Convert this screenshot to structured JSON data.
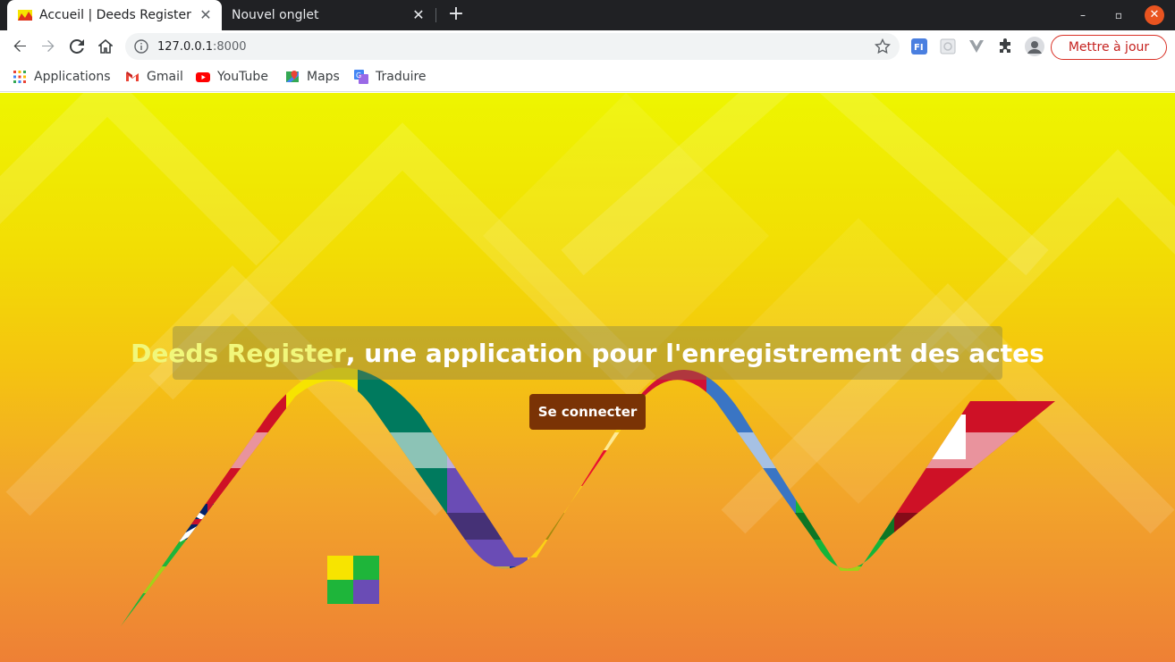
{
  "browser": {
    "tabs": [
      {
        "title": "Accueil | Deeds Register",
        "active": true
      },
      {
        "title": "Nouvel onglet",
        "active": false
      }
    ],
    "close_glyph": "✕",
    "new_tab_glyph": "+",
    "window_buttons": {
      "minimize": "–",
      "maximize": "▫",
      "close": "✕"
    },
    "url_host": "127.0.0.1",
    "url_port": ":8000",
    "update_button": "Mettre à jour"
  },
  "bookmarks": [
    {
      "label": "Applications",
      "icon": "apps-grid-icon"
    },
    {
      "label": "Gmail",
      "icon": "gmail-icon"
    },
    {
      "label": "YouTube",
      "icon": "youtube-icon"
    },
    {
      "label": "Maps",
      "icon": "maps-icon"
    },
    {
      "label": "Traduire",
      "icon": "translate-icon"
    }
  ],
  "hero": {
    "brand": "Deeds Register",
    "tagline": ", une application pour l'enregistrement des actes",
    "login_button": "Se connecter"
  },
  "colors": {
    "accent": "#7a3305",
    "brand_text": "#f1f77a",
    "update_red": "#c5221f"
  }
}
